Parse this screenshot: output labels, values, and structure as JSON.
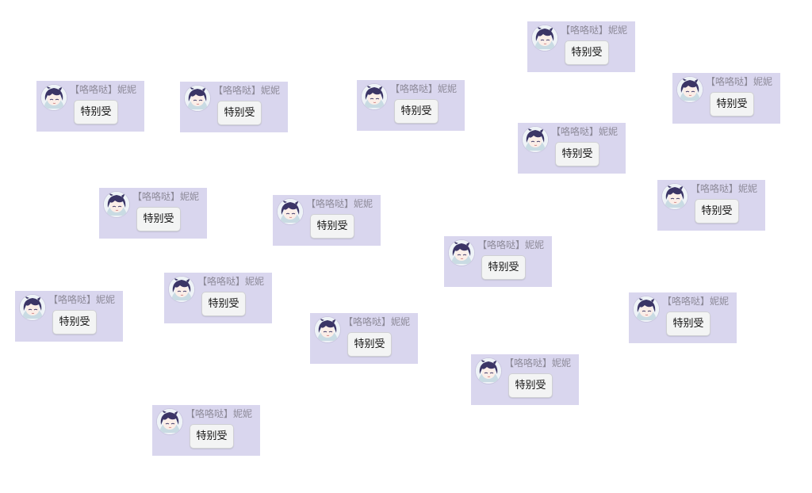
{
  "messages": [
    {
      "sender": "【咯咯哒】妮妮",
      "text": "特别受",
      "avatar_icon": "anime-character-avatar-icon"
    },
    {
      "sender": "【咯咯哒】妮妮",
      "text": "特别受",
      "avatar_icon": "anime-character-avatar-icon"
    },
    {
      "sender": "【咯咯哒】妮妮",
      "text": "特别受",
      "avatar_icon": "anime-character-avatar-icon"
    },
    {
      "sender": "【咯咯哒】妮妮",
      "text": "特别受",
      "avatar_icon": "anime-character-avatar-icon"
    },
    {
      "sender": "【咯咯哒】妮妮",
      "text": "特别受",
      "avatar_icon": "anime-character-avatar-icon"
    },
    {
      "sender": "【咯咯哒】妮妮",
      "text": "特别受",
      "avatar_icon": "anime-character-avatar-icon"
    },
    {
      "sender": "【咯咯哒】妮妮",
      "text": "特别受",
      "avatar_icon": "anime-character-avatar-icon"
    },
    {
      "sender": "【咯咯哒】妮妮",
      "text": "特别受",
      "avatar_icon": "anime-character-avatar-icon"
    },
    {
      "sender": "【咯咯哒】妮妮",
      "text": "特别受",
      "avatar_icon": "anime-character-avatar-icon"
    },
    {
      "sender": "【咯咯哒】妮妮",
      "text": "特别受",
      "avatar_icon": "anime-character-avatar-icon"
    },
    {
      "sender": "【咯咯哒】妮妮",
      "text": "特别受",
      "avatar_icon": "anime-character-avatar-icon"
    },
    {
      "sender": "【咯咯哒】妮妮",
      "text": "特别受",
      "avatar_icon": "anime-character-avatar-icon"
    },
    {
      "sender": "【咯咯哒】妮妮",
      "text": "特别受",
      "avatar_icon": "anime-character-avatar-icon"
    },
    {
      "sender": "【咯咯哒】妮妮",
      "text": "特别受",
      "avatar_icon": "anime-character-avatar-icon"
    },
    {
      "sender": "【咯咯哒】妮妮",
      "text": "特别受",
      "avatar_icon": "anime-character-avatar-icon"
    },
    {
      "sender": "【咯咯哒】妮妮",
      "text": "特别受",
      "avatar_icon": "anime-character-avatar-icon"
    }
  ],
  "colors": {
    "card_background": "#d9d6ee",
    "bubble_background": "#f3f4f4",
    "sender_text": "#8d8a98",
    "message_text": "#111111"
  }
}
